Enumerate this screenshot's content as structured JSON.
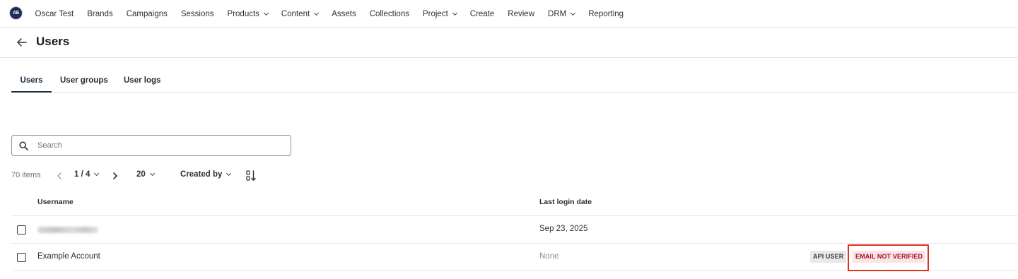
{
  "app": {
    "logo_text": "AE"
  },
  "nav": {
    "items": [
      {
        "label": "Oscar Test",
        "dropdown": false
      },
      {
        "label": "Brands",
        "dropdown": false
      },
      {
        "label": "Campaigns",
        "dropdown": false
      },
      {
        "label": "Sessions",
        "dropdown": false
      },
      {
        "label": "Products",
        "dropdown": true
      },
      {
        "label": "Content",
        "dropdown": true
      },
      {
        "label": "Assets",
        "dropdown": false
      },
      {
        "label": "Collections",
        "dropdown": false
      },
      {
        "label": "Project",
        "dropdown": true
      },
      {
        "label": "Create",
        "dropdown": false
      },
      {
        "label": "Review",
        "dropdown": false
      },
      {
        "label": "DRM",
        "dropdown": true
      },
      {
        "label": "Reporting",
        "dropdown": false
      }
    ]
  },
  "header": {
    "title": "Users",
    "back_icon": "arrow-left-icon"
  },
  "tabs": [
    {
      "label": "Users",
      "active": true
    },
    {
      "label": "User groups",
      "active": false
    },
    {
      "label": "User logs",
      "active": false
    }
  ],
  "search": {
    "placeholder": "Search",
    "value": ""
  },
  "toolbar": {
    "count": "70 items",
    "page": "1 / 4",
    "per_page": "20",
    "sort_by": "Created by"
  },
  "table": {
    "columns": {
      "username": "Username",
      "last_login": "Last login date"
    },
    "rows": [
      {
        "username": "",
        "username_redacted": true,
        "last_login": "Sep 23, 2025",
        "badges": []
      },
      {
        "username": "Example Account",
        "username_redacted": false,
        "last_login": "None",
        "badges": [
          "API USER",
          "EMAIL NOT VERIFIED"
        ]
      }
    ]
  },
  "colors": {
    "accent": "#1b2a44",
    "badge_error_bg": "#fbe4e6",
    "badge_error_text": "#a3122b",
    "highlight": "#e0321c"
  }
}
